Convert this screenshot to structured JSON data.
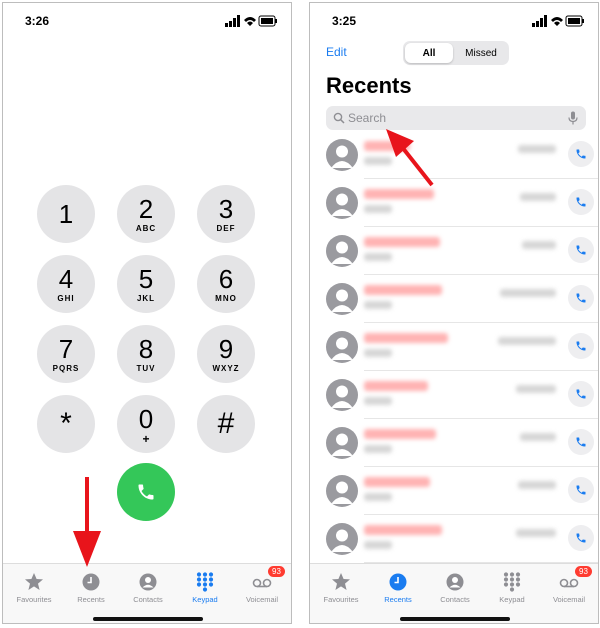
{
  "left": {
    "status": {
      "time": "3:26"
    },
    "keypad": [
      {
        "digit": "1",
        "letters": ""
      },
      {
        "digit": "2",
        "letters": "ABC"
      },
      {
        "digit": "3",
        "letters": "DEF"
      },
      {
        "digit": "4",
        "letters": "GHI"
      },
      {
        "digit": "5",
        "letters": "JKL"
      },
      {
        "digit": "6",
        "letters": "MNO"
      },
      {
        "digit": "7",
        "letters": "PQRS"
      },
      {
        "digit": "8",
        "letters": "TUV"
      },
      {
        "digit": "9",
        "letters": "WXYZ"
      },
      {
        "digit": "*",
        "letters": ""
      },
      {
        "digit": "0",
        "letters": "+"
      },
      {
        "digit": "#",
        "letters": ""
      }
    ],
    "tabs": [
      {
        "label": "Favourites",
        "icon": "star-icon"
      },
      {
        "label": "Recents",
        "icon": "clock-icon"
      },
      {
        "label": "Contacts",
        "icon": "person-icon"
      },
      {
        "label": "Keypad",
        "icon": "keypad-icon",
        "active": true
      },
      {
        "label": "Voicemail",
        "icon": "voicemail-icon",
        "badge": "93"
      }
    ]
  },
  "right": {
    "status": {
      "time": "3:25"
    },
    "edit_label": "Edit",
    "segments": {
      "all": "All",
      "missed": "Missed"
    },
    "title": "Recents",
    "search": {
      "placeholder": "Search"
    },
    "recents_count": 9,
    "tabs": [
      {
        "label": "Favourites",
        "icon": "star-icon"
      },
      {
        "label": "Recents",
        "icon": "clock-icon",
        "active": true
      },
      {
        "label": "Contacts",
        "icon": "person-icon"
      },
      {
        "label": "Keypad",
        "icon": "keypad-icon"
      },
      {
        "label": "Voicemail",
        "icon": "voicemail-icon",
        "badge": "93"
      }
    ]
  },
  "colors": {
    "accent": "#1a7cf0",
    "call_green": "#34c759",
    "key_gray": "#e4e4e6",
    "badge_red": "#ff3b30",
    "annotation_red": "#e8141b"
  }
}
